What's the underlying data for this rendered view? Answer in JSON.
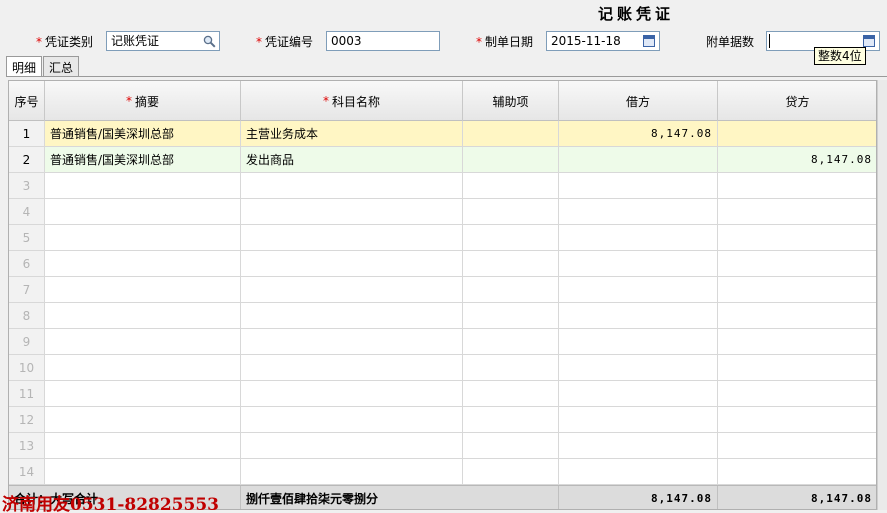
{
  "title": "记账凭证",
  "header": {
    "voucher_type_label": "凭证类别",
    "voucher_type_value": "记账凭证",
    "voucher_no_label": "凭证编号",
    "voucher_no_value": "0003",
    "date_label": "制单日期",
    "date_value": "2015-11-18",
    "attachments_label": "附单据数",
    "attachments_value": "",
    "tooltip": "整数4位"
  },
  "tabs": [
    {
      "label": "明细",
      "active": true
    },
    {
      "label": "汇总",
      "active": false
    }
  ],
  "columns": {
    "index": "序号",
    "summary": "摘要",
    "account": "科目名称",
    "auxiliary": "辅助项",
    "debit": "借方",
    "credit": "贷方"
  },
  "rows": [
    {
      "index": "1",
      "summary": "普通销售/国美深圳总部",
      "account": "主营业务成本",
      "auxiliary": "",
      "debit": "8,147.08",
      "credit": ""
    },
    {
      "index": "2",
      "summary": "普通销售/国美深圳总部",
      "account": "发出商品",
      "auxiliary": "",
      "debit": "",
      "credit": "8,147.08"
    },
    {
      "index": "3"
    },
    {
      "index": "4"
    },
    {
      "index": "5"
    },
    {
      "index": "6"
    },
    {
      "index": "7"
    },
    {
      "index": "8"
    },
    {
      "index": "9"
    },
    {
      "index": "10"
    },
    {
      "index": "11"
    },
    {
      "index": "12"
    },
    {
      "index": "13"
    },
    {
      "index": "14"
    }
  ],
  "total": {
    "label": "合计：大写合计",
    "amount_in_words": "捌仟壹佰肆拾柒元零捌分",
    "debit": "8,147.08",
    "credit": "8,147.08"
  },
  "watermark": "济南用友0531-82825553",
  "colors": {
    "required_mark": "#d00000",
    "row1_bg": "#fff6c4",
    "row2_bg": "#eefbe9",
    "watermark": "#c00000"
  },
  "icons": {
    "voucher_type_lookup": "magnifier-icon",
    "date_picker": "calendar-icon",
    "attachments_picker": "calendar-icon"
  }
}
